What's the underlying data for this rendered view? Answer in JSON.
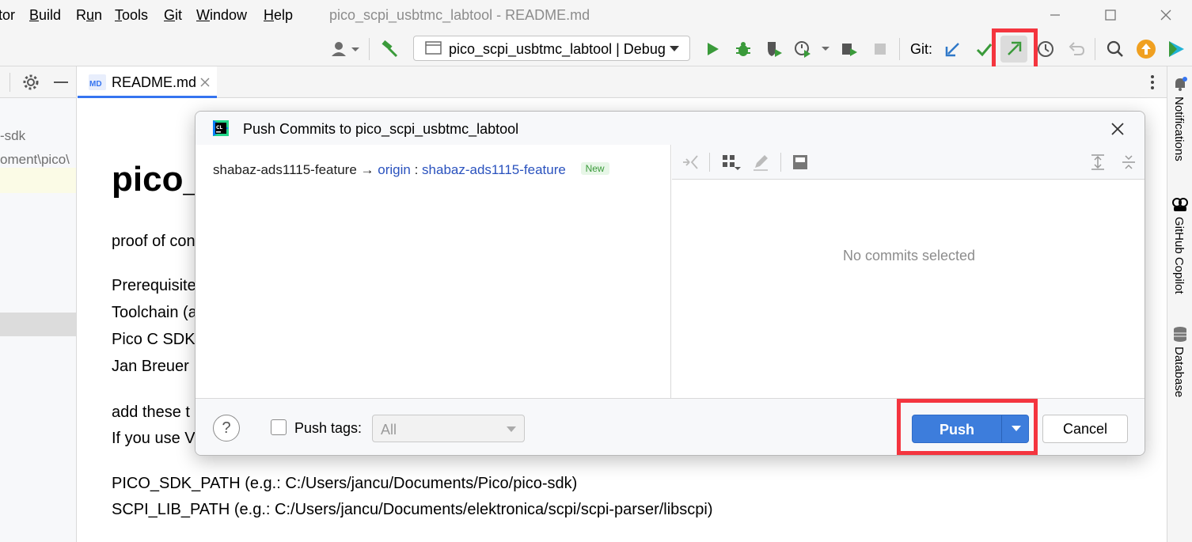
{
  "menu": {
    "items": [
      {
        "label": "tor",
        "key": ""
      },
      {
        "label": "Build",
        "key": "B"
      },
      {
        "label": "Run",
        "key": "u"
      },
      {
        "label": "Tools",
        "key": "T"
      },
      {
        "label": "Git",
        "key": "G"
      },
      {
        "label": "Window",
        "key": "W"
      },
      {
        "label": "Help",
        "key": "H"
      }
    ],
    "window_title": "pico_scpi_usbtmc_labtool - README.md"
  },
  "toolbar": {
    "run_config": "pico_scpi_usbtmc_labtool | Debug",
    "git_label": "Git:",
    "icons": [
      "user-icon",
      "hammer-icon",
      "run-icon",
      "debug-icon",
      "coverage-icon",
      "profile-icon",
      "attach-icon",
      "stop-icon",
      "update-icon",
      "commit-icon",
      "push-icon",
      "history-icon",
      "rollback-icon",
      "search-icon",
      "update-app-icon",
      "ai-icon"
    ]
  },
  "left_panel": {
    "lines": [
      "-sdk",
      "oment\\pico\\"
    ]
  },
  "editor": {
    "tab_label": "README.md",
    "tab_icon_text": "MD",
    "heading": "pico_",
    "lines": [
      "proof of con",
      "Prerequisite",
      "Toolchain (a",
      "Pico C SDK",
      "Jan Breuer",
      "add these t",
      "If you use V",
      "PICO_SDK_PATH (e.g.: C:/Users/jancu/Documents/Pico/pico-sdk)",
      "SCPI_LIB_PATH (e.g.: C:/Users/jancu/Documents/elektronica/scpi/scpi-parser/libscpi)"
    ]
  },
  "right_strip": {
    "notifications": "Notifications",
    "copilot": "GitHub Copilot",
    "database": "Database"
  },
  "dialog": {
    "title": "Push Commits to pico_scpi_usbtmc_labtool",
    "branch_local": "shabaz-ads1115-feature",
    "arrow": "→",
    "remote": "origin",
    "separator": ":",
    "branch_remote": "shabaz-ads1115-feature",
    "new_badge": "New",
    "no_commits": "No commits selected",
    "help": "?",
    "push_tags_label": "Push tags:",
    "push_tags_value": "All",
    "push_label": "Push",
    "cancel_label": "Cancel"
  },
  "colors": {
    "accent": "#3d7ddc",
    "highlight": "#f4353f",
    "link": "#2a52be",
    "run_green": "#3a9a3a"
  }
}
